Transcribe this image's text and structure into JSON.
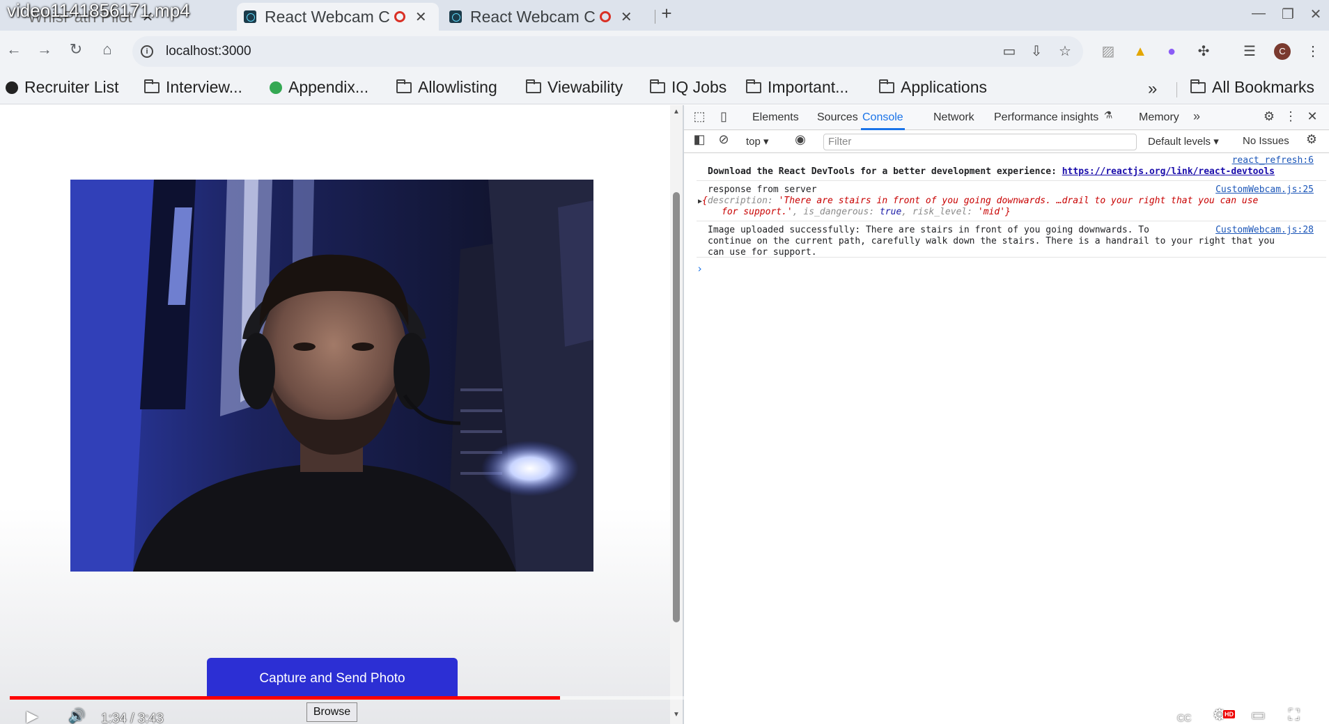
{
  "video": {
    "title": "video1141856171.mp4",
    "time": "1:34 / 3:43",
    "progress_fraction": 0.4215,
    "controls": {
      "play": "▶",
      "volume": "🔊",
      "cc": "CC",
      "settings": "⚙",
      "hd": "HD",
      "miniplayer": "▭",
      "fullscreen": "⛶"
    }
  },
  "browser": {
    "tabs": [
      {
        "label": "WhisPath Pilot",
        "faded": true
      },
      {
        "label": "React Webcam C",
        "active": true
      },
      {
        "label": "React Webcam C",
        "active": false
      }
    ],
    "new_tab": "+",
    "window": {
      "minimize": "—",
      "restore": "❐",
      "close": "✕"
    },
    "url": "localhost:3000",
    "nav": {
      "back": "←",
      "forward": "→",
      "reload": "↻",
      "home": "⌂"
    },
    "avatar_letter": "C"
  },
  "bookmarks": {
    "items": [
      "Recruiter List",
      "Interview...",
      "Appendix...",
      "Allowlisting",
      "Viewability",
      "IQ Jobs",
      "Important...",
      "Applications"
    ],
    "more": "»",
    "all": "All Bookmarks"
  },
  "page": {
    "capture_label": "Capture and Send Photo",
    "browse_label": "Browse"
  },
  "devtools": {
    "tabs": [
      "Elements",
      "Sources",
      "Console",
      "Network",
      "Performance insights",
      "Memory"
    ],
    "active_tab": "Console",
    "context": "top",
    "filter_placeholder": "Filter",
    "levels": "Default levels",
    "issues": "No Issues",
    "console": {
      "msg1_src": "react_refresh:6",
      "msg1_text": "Download the React DevTools for a better development experience: ",
      "msg1_link": "https://reactjs.org/link/react-devtools",
      "msg2_text": "response from server",
      "msg2_src": "CustomWebcam.js:25",
      "msg2_obj_open": "{",
      "msg2_key_desc": "description",
      "msg2_desc_val": "'There are stairs in front of you going downwards. …drail to your right that you can use",
      "msg2_desc_val2": "for support.'",
      "msg2_key_danger": "is_dangerous",
      "msg2_danger_val": "true",
      "msg2_key_risk": "risk_level",
      "msg2_risk_val": "'mid'",
      "msg2_obj_close": "}",
      "msg3_src": "CustomWebcam.js:28",
      "msg3_line1": "Image uploaded successfully: There are stairs in front of you going downwards. To",
      "msg3_line2": "continue on the current path, carefully walk down the stairs. There is a handrail to your right that you",
      "msg3_line3": "can use for support.",
      "prompt": "›"
    }
  }
}
